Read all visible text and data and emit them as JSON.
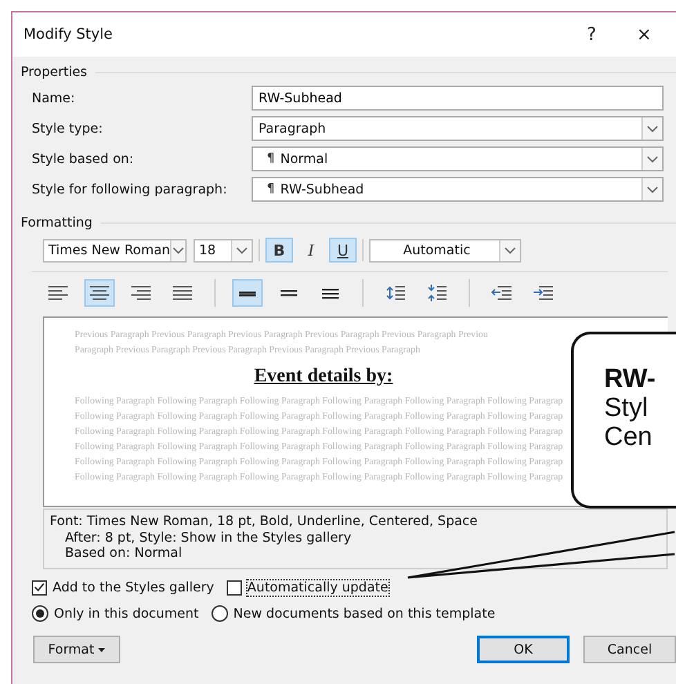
{
  "window": {
    "title": "Modify Style",
    "help": "?",
    "close": "×"
  },
  "properties": {
    "heading": "Properties",
    "fields": [
      {
        "label": "Name:",
        "kind": "text",
        "value": "RW-Subhead"
      },
      {
        "label": "Style type:",
        "kind": "select",
        "value": "Paragraph"
      },
      {
        "label": "Style based on:",
        "kind": "select",
        "prefix": "¶",
        "value": "Normal"
      },
      {
        "label": "Style for following paragraph:",
        "kind": "select",
        "prefix": "¶",
        "value": "RW-Subhead"
      }
    ]
  },
  "formatting": {
    "heading": "Formatting",
    "font": "Times New Roman",
    "size": "18",
    "styles": [
      {
        "kind": "bold",
        "label": "B",
        "selected": true
      },
      {
        "kind": "italic",
        "label": "I",
        "selected": false
      },
      {
        "kind": "underline",
        "label": "U",
        "selected": true
      }
    ],
    "font_color_choice": "Automatic",
    "paragraph_buttons": [
      {
        "kind": "align-left",
        "selected": false
      },
      {
        "kind": "align-center",
        "selected": true
      },
      {
        "kind": "align-right",
        "selected": false
      },
      {
        "kind": "justify",
        "selected": false
      },
      {
        "kind": "sep"
      },
      {
        "kind": "single",
        "selected": true
      },
      {
        "kind": "one-half",
        "selected": false
      },
      {
        "kind": "double",
        "selected": false
      },
      {
        "kind": "sep"
      },
      {
        "kind": "space-more",
        "selected": false
      },
      {
        "kind": "space-less",
        "selected": false
      },
      {
        "kind": "sep"
      },
      {
        "kind": "outdent",
        "selected": false
      },
      {
        "kind": "indent",
        "selected": false
      }
    ]
  },
  "preview": {
    "previous": [
      "Previous Paragraph Previous Paragraph Previous Paragraph Previous Paragraph Previous Paragraph Previou",
      "Paragraph Previous Paragraph Previous Paragraph Previous Paragraph Previous Paragraph"
    ],
    "sample": "Event details by:",
    "following": [
      "Following Paragraph Following Paragraph Following Paragraph Following Paragraph Following Paragraph Following Paragrap",
      "Following Paragraph Following Paragraph Following Paragraph Following Paragraph Following Paragraph Following Paragrap",
      "Following Paragraph Following Paragraph Following Paragraph Following Paragraph Following Paragraph Following Paragrap",
      "Following Paragraph Following Paragraph Following Paragraph Following Paragraph Following Paragraph Following Paragrap",
      "Following Paragraph Following Paragraph Following Paragraph Following Paragraph Following Paragraph Following Paragrap",
      "Following Paragraph Following Paragraph Following Paragraph Following Paragraph Following Paragraph Following Paragrap"
    ]
  },
  "description": [
    "Font: Times New Roman, 18 pt, Bold, Underline, Centered, Space",
    "After:  8 pt, Style: Show in the Styles gallery",
    "Based on: Normal"
  ],
  "options": [
    {
      "label": "Add to the Styles gallery",
      "checked": true
    },
    {
      "label": "Automatically update",
      "checked": false
    }
  ],
  "scope": [
    {
      "label": "Only in this document",
      "selected": true
    },
    {
      "label": "New documents based on this template",
      "selected": false
    }
  ],
  "buttons": {
    "format": "Format",
    "ok": "OK",
    "cancel": "Cancel"
  },
  "callout": [
    "RW-",
    "Styl",
    "Cen"
  ]
}
